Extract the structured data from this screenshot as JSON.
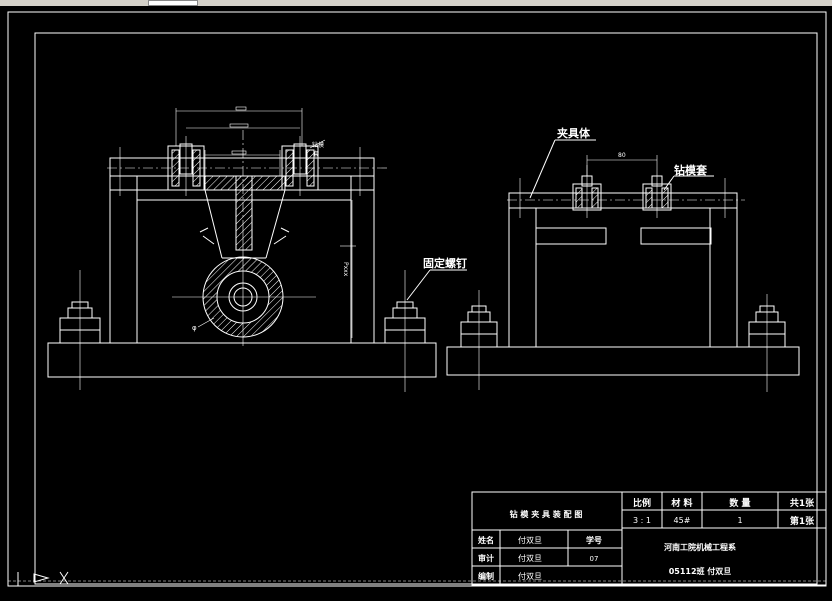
{
  "labels": {
    "clamp_body": "夹具体",
    "drill_sleeve": "钻模套",
    "fixing_screw": "固定螺钉",
    "dim_phi": "φ",
    "dim_right_top": "80"
  },
  "title_block": {
    "drawing_title": "钻 模 夹 具 装 配 图",
    "scale_label": "比例",
    "scale_value": "3 : 1",
    "material_label": "材 料",
    "material_value": "45#",
    "quantity_label": "数 量",
    "quantity_value": "1",
    "sheets_total": "共1张",
    "sheet_no": "第1张",
    "name_label": "姓名",
    "name_value": "付双旦",
    "student_no_label": "学号",
    "student_no_value": "07",
    "review_label": "审计",
    "review_value": "付双旦",
    "drawn_label": "编制",
    "drawn_value": "付双旦",
    "school": "河南工院机械工程系",
    "class_name": "05112班 付双旦"
  },
  "colors": {
    "background": "#000000",
    "lines": "#ffffff",
    "toolbar": "#d4d0c8"
  }
}
